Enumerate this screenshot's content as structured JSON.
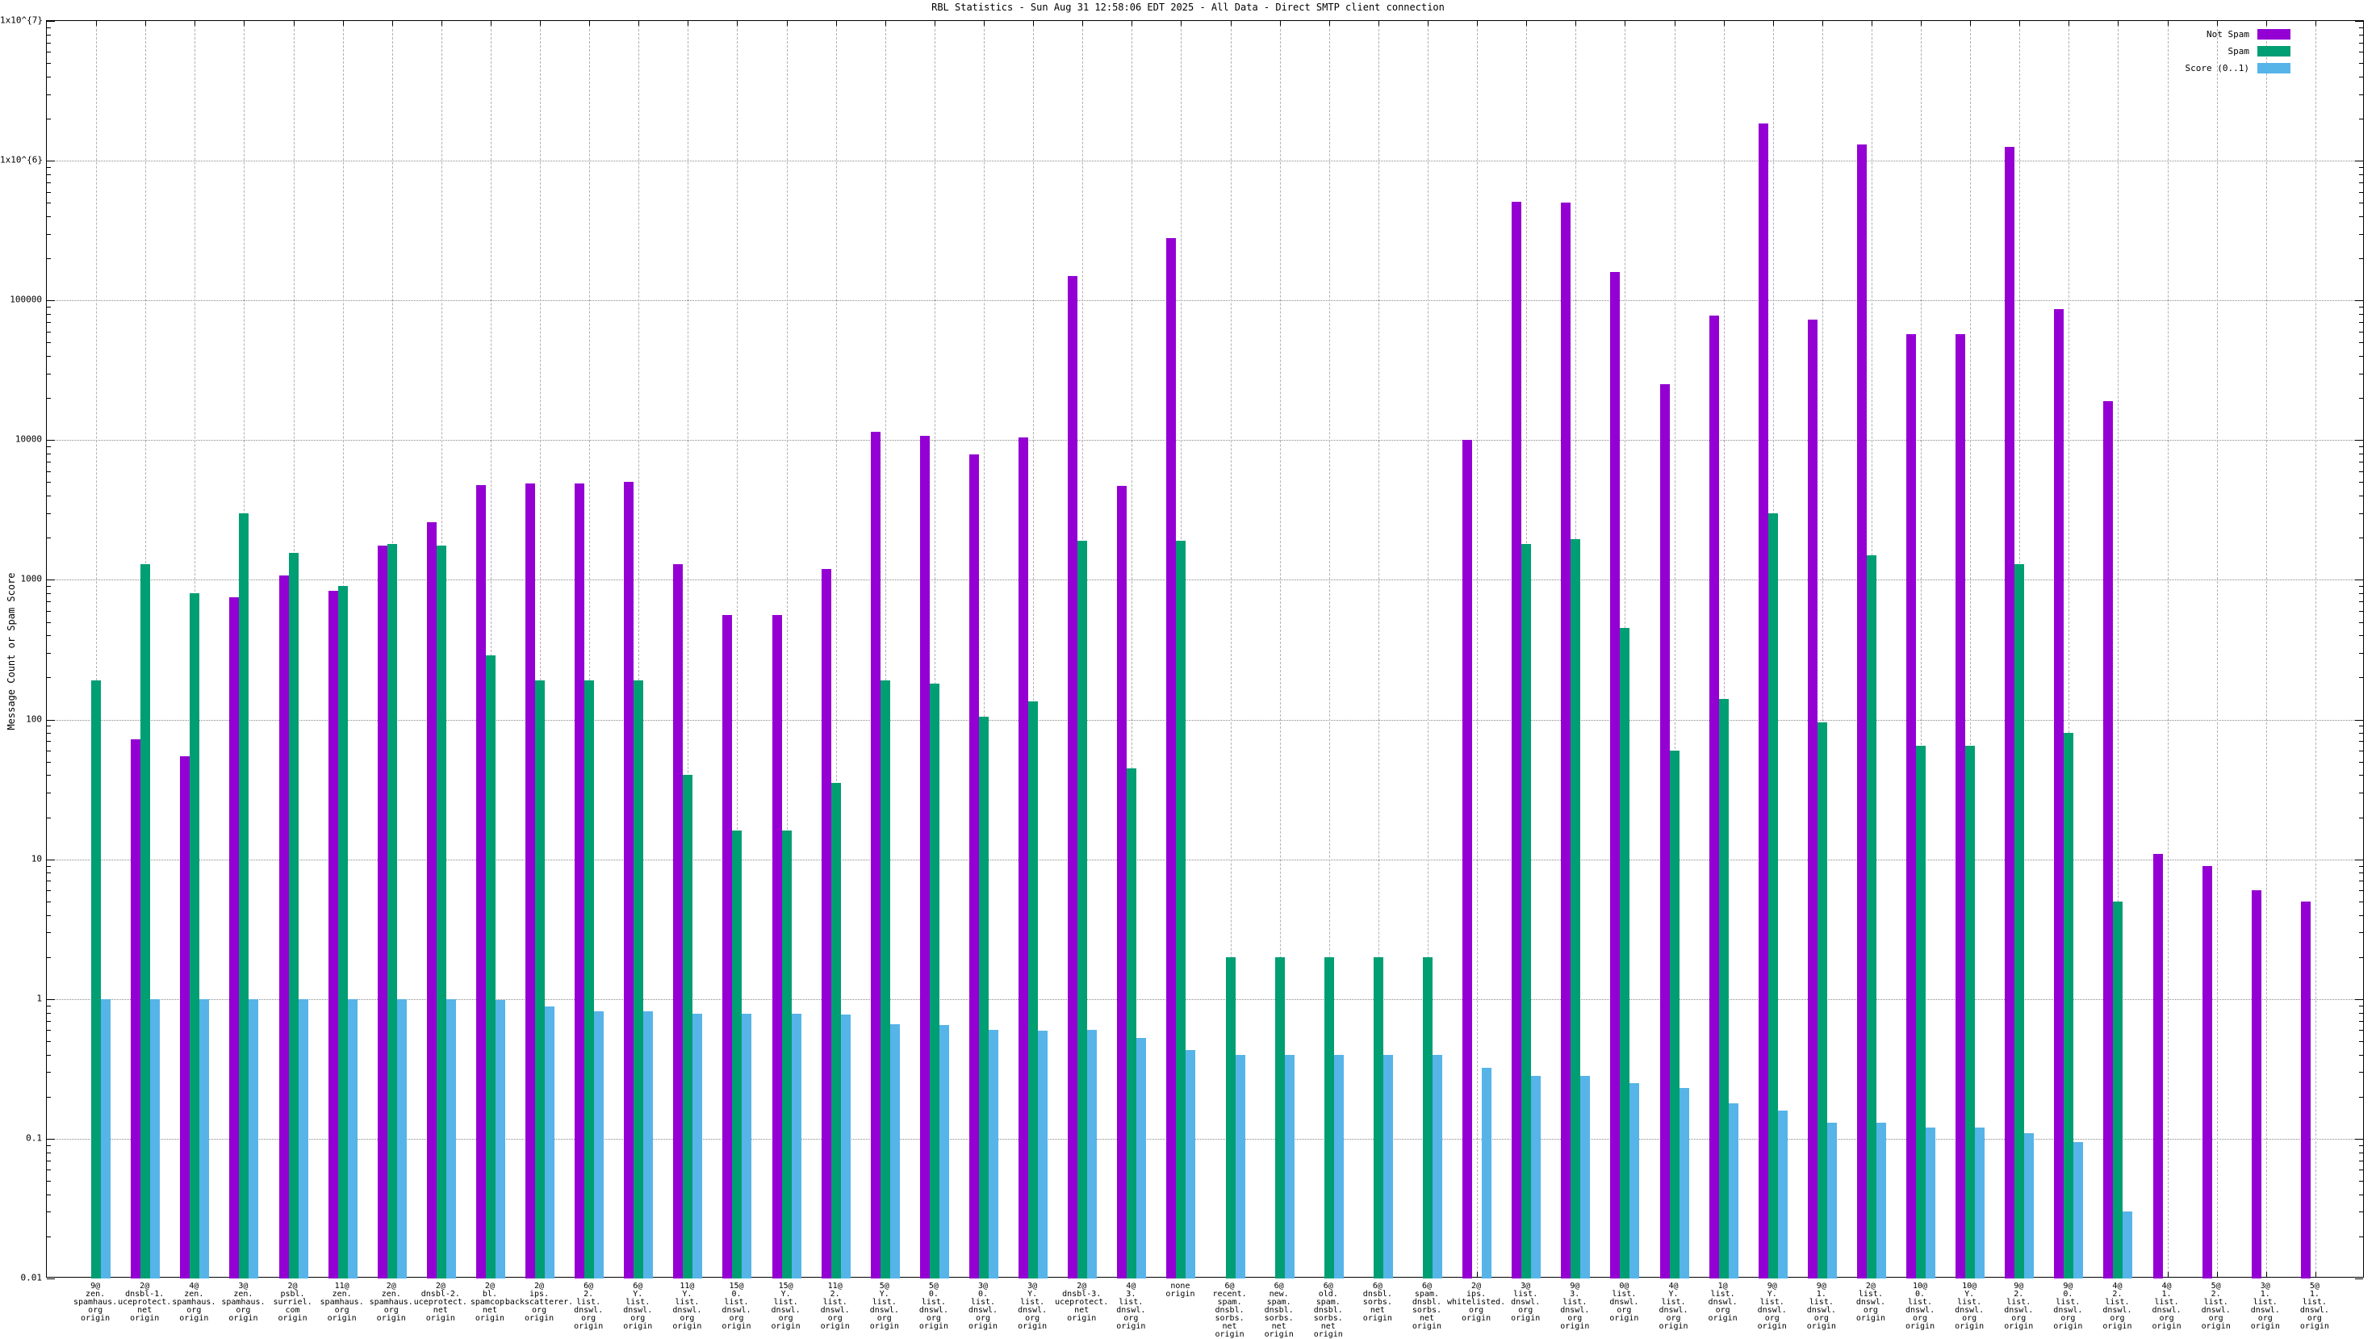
{
  "title": "RBL Statistics - Sun Aug 31 12:58:06 EDT 2025 - All Data - Direct SMTP client connection",
  "y_axis": {
    "label": "Message Count or Spam Score",
    "ticks": [
      {
        "v": 0.01,
        "label": "0.01"
      },
      {
        "v": 0.1,
        "label": "0.1"
      },
      {
        "v": 1,
        "label": "1"
      },
      {
        "v": 10,
        "label": "10"
      },
      {
        "v": 100,
        "label": "100"
      },
      {
        "v": 1000,
        "label": "1000"
      },
      {
        "v": 10000,
        "label": "10000"
      },
      {
        "v": 100000,
        "label": "100000"
      },
      {
        "v": 1000000,
        "label": "1x10^{6}"
      },
      {
        "v": 10000000,
        "label": "1x10^{7}"
      }
    ]
  },
  "legend": [
    {
      "label": "Not Spam",
      "series": "not_spam",
      "color": "#9400d3"
    },
    {
      "label": "Spam",
      "series": "spam",
      "color": "#009e73"
    },
    {
      "label": "Score (0..1)",
      "series": "score",
      "color": "#56b4e9"
    }
  ],
  "chart_data": {
    "type": "bar",
    "log_scale": true,
    "ylim": [
      0.01,
      10000000
    ],
    "grid": true,
    "legend_position": "top-right",
    "series_names": [
      "Not Spam",
      "Spam",
      "Score (0..1)"
    ],
    "colors": {
      "not_spam": "#9400d3",
      "spam": "#009e73",
      "score": "#56b4e9"
    },
    "groups": [
      {
        "label": "9@zen.spamhaus.org origin",
        "label_lines": [
          "9@",
          "zen.",
          "spamhaus.",
          "org",
          "origin"
        ],
        "not_spam": null,
        "spam": 190,
        "score": 1.0
      },
      {
        "label": "2@dnsbl-1.uceprotect.net origin",
        "label_lines": [
          "2@",
          "dnsbl-1.",
          "uceprotect.",
          "net",
          "origin"
        ],
        "not_spam": 72,
        "spam": 1300,
        "score": 1.0
      },
      {
        "label": "4@zen.spamhaus.org origin",
        "label_lines": [
          "4@",
          "zen.",
          "spamhaus.",
          "org",
          "origin"
        ],
        "not_spam": 55,
        "spam": 800,
        "score": 1.0
      },
      {
        "label": "3@zen.spamhaus.org origin",
        "label_lines": [
          "3@",
          "zen.",
          "spamhaus.",
          "org",
          "origin"
        ],
        "not_spam": 750,
        "spam": 3000,
        "score": 1.0
      },
      {
        "label": "2@psbl.surriel.com origin",
        "label_lines": [
          "2@",
          "psbl.",
          "surriel.",
          "com",
          "origin"
        ],
        "not_spam": 1080,
        "spam": 1550,
        "score": 1.0
      },
      {
        "label": "11@zen.spamhaus.org origin",
        "label_lines": [
          "11@",
          "zen.",
          "spamhaus.",
          "org",
          "origin"
        ],
        "not_spam": 830,
        "spam": 910,
        "score": 1.0
      },
      {
        "label": "2@zen.spamhaus.org origin",
        "label_lines": [
          "2@",
          "zen.",
          "spamhaus.",
          "org",
          "origin"
        ],
        "not_spam": 1750,
        "spam": 1800,
        "score": 1.0
      },
      {
        "label": "2@dnsbl-2.uceprotect.net origin",
        "label_lines": [
          "2@",
          "dnsbl-2.",
          "uceprotect.",
          "net",
          "origin"
        ],
        "not_spam": 2600,
        "spam": 1750,
        "score": 1.0
      },
      {
        "label": "2@bl.spamcop.net origin",
        "label_lines": [
          "2@",
          "bl.",
          "spamcop.",
          "net",
          "origin"
        ],
        "not_spam": 4800,
        "spam": 290,
        "score": 0.98
      },
      {
        "label": "2@ips.backscatterer.org origin",
        "label_lines": [
          "2@",
          "ips.",
          "backscatterer.",
          "org",
          "origin"
        ],
        "not_spam": 4900,
        "spam": 190,
        "score": 0.88
      },
      {
        "label": "6@2.list.dnswl.org origin",
        "label_lines": [
          "6@",
          "2.",
          "list.",
          "dnswl.",
          "org",
          "origin"
        ],
        "not_spam": 4900,
        "spam": 190,
        "score": 0.82
      },
      {
        "label": "6@Y.list.dnswl.org origin",
        "label_lines": [
          "6@",
          "Y.",
          "list.",
          "dnswl.",
          "org",
          "origin"
        ],
        "not_spam": 5000,
        "spam": 190,
        "score": 0.82
      },
      {
        "label": "11@Y.list.dnswl.org origin",
        "label_lines": [
          "11@",
          "Y.",
          "list.",
          "dnswl.",
          "org",
          "origin"
        ],
        "not_spam": 1300,
        "spam": 40,
        "score": 0.78
      },
      {
        "label": "15@0.list.dnswl.org origin",
        "label_lines": [
          "15@",
          "0.",
          "list.",
          "dnswl.",
          "org",
          "origin"
        ],
        "not_spam": 560,
        "spam": 16,
        "score": 0.78
      },
      {
        "label": "15@Y.list.dnswl.org origin",
        "label_lines": [
          "15@",
          "Y.",
          "list.",
          "dnswl.",
          "org",
          "origin"
        ],
        "not_spam": 560,
        "spam": 16,
        "score": 0.78
      },
      {
        "label": "11@2.list.dnswl.org origin",
        "label_lines": [
          "11@",
          "2.",
          "list.",
          "dnswl.",
          "org",
          "origin"
        ],
        "not_spam": 1200,
        "spam": 35,
        "score": 0.77
      },
      {
        "label": "5@Y.list.dnswl.org origin",
        "label_lines": [
          "5@",
          "Y.",
          "list.",
          "dnswl.",
          "org",
          "origin"
        ],
        "not_spam": 11500,
        "spam": 190,
        "score": 0.66
      },
      {
        "label": "5@0.list.dnswl.org origin",
        "label_lines": [
          "5@",
          "0.",
          "list.",
          "dnswl.",
          "org",
          "origin"
        ],
        "not_spam": 10700,
        "spam": 180,
        "score": 0.65
      },
      {
        "label": "3@0.list.dnswl.org origin",
        "label_lines": [
          "3@",
          "0.",
          "list.",
          "dnswl.",
          "org",
          "origin"
        ],
        "not_spam": 7900,
        "spam": 105,
        "score": 0.6
      },
      {
        "label": "3@Y.list.dnswl.org origin",
        "label_lines": [
          "3@",
          "Y.",
          "list.",
          "dnswl.",
          "org",
          "origin"
        ],
        "not_spam": 10500,
        "spam": 135,
        "score": 0.59
      },
      {
        "label": "2@dnsbl-3.uceprotect.net origin",
        "label_lines": [
          "2@",
          "dnsbl-3.",
          "uceprotect.",
          "net",
          "origin"
        ],
        "not_spam": 150000,
        "spam": 1900,
        "score": 0.6
      },
      {
        "label": "4@3.list.dnswl.org origin",
        "label_lines": [
          "4@",
          "3.",
          "list.",
          "dnswl.",
          "org",
          "origin"
        ],
        "not_spam": 4700,
        "spam": 45,
        "score": 0.53
      },
      {
        "label": "none origin",
        "label_lines": [
          "none",
          "origin"
        ],
        "not_spam": 280000,
        "spam": 1900,
        "score": 0.43
      },
      {
        "label": "6@recent.spam.dnsbl.sorbs.net origin",
        "label_lines": [
          "6@",
          "recent.",
          "spam.",
          "dnsbl.",
          "sorbs.",
          "net",
          "origin"
        ],
        "not_spam": null,
        "spam": 2,
        "score": 0.4
      },
      {
        "label": "6@new.spam.dnsbl.sorbs.net origin",
        "label_lines": [
          "6@",
          "new.",
          "spam.",
          "dnsbl.",
          "sorbs.",
          "net",
          "origin"
        ],
        "not_spam": null,
        "spam": 2,
        "score": 0.4
      },
      {
        "label": "6@old.spam.dnsbl.sorbs.net origin",
        "label_lines": [
          "6@",
          "old.",
          "spam.",
          "dnsbl.",
          "sorbs.",
          "net",
          "origin"
        ],
        "not_spam": null,
        "spam": 2,
        "score": 0.4
      },
      {
        "label": "6@dnsbl.sorbs.net origin",
        "label_lines": [
          "6@",
          "dnsbl.",
          "sorbs.",
          "net",
          "origin"
        ],
        "not_spam": null,
        "spam": 2,
        "score": 0.4
      },
      {
        "label": "6@spam.dnsbl.sorbs.net origin",
        "label_lines": [
          "6@",
          "spam.",
          "dnsbl.",
          "sorbs.",
          "net",
          "origin"
        ],
        "not_spam": null,
        "spam": 2,
        "score": 0.4
      },
      {
        "label": "2@ips.whitelisted.org origin",
        "label_lines": [
          "2@",
          "ips.",
          "whitelisted.",
          "org",
          "origin"
        ],
        "not_spam": 10000,
        "spam": null,
        "score": 0.32
      },
      {
        "label": "3@list.dnswl.org origin",
        "label_lines": [
          "3@",
          "list.",
          "dnswl.",
          "org",
          "origin"
        ],
        "not_spam": 510000,
        "spam": 1800,
        "score": 0.28
      },
      {
        "label": "9@3.list.dnswl.org origin",
        "label_lines": [
          "9@",
          "3.",
          "list.",
          "dnswl.",
          "org",
          "origin"
        ],
        "not_spam": 500000,
        "spam": 1950,
        "score": 0.28
      },
      {
        "label": "0@list.dnswl.org origin",
        "label_lines": [
          "0@",
          "list.",
          "dnswl.",
          "org",
          "origin"
        ],
        "not_spam": 160000,
        "spam": 450,
        "score": 0.25
      },
      {
        "label": "4@Y.list.dnswl.org origin",
        "label_lines": [
          "4@",
          "Y.",
          "list.",
          "dnswl.",
          "org",
          "origin"
        ],
        "not_spam": 25000,
        "spam": 60,
        "score": 0.23
      },
      {
        "label": "1@list.dnswl.org origin",
        "label_lines": [
          "1@",
          "list.",
          "dnswl.",
          "org",
          "origin"
        ],
        "not_spam": 78000,
        "spam": 140,
        "score": 0.18
      },
      {
        "label": "9@Y.list.dnswl.org origin",
        "label_lines": [
          "9@",
          "Y.",
          "list.",
          "dnswl.",
          "org",
          "origin"
        ],
        "not_spam": 1850000,
        "spam": 3000,
        "score": 0.16
      },
      {
        "label": "9@1.list.dnswl.org origin",
        "label_lines": [
          "9@",
          "1.",
          "list.",
          "dnswl.",
          "org",
          "origin"
        ],
        "not_spam": 73000,
        "spam": 95,
        "score": 0.13
      },
      {
        "label": "2@list.dnswl.org origin",
        "label_lines": [
          "2@",
          "list.",
          "dnswl.",
          "org",
          "origin"
        ],
        "not_spam": 1300000,
        "spam": 1500,
        "score": 0.13
      },
      {
        "label": "10@0.list.dnswl.org origin",
        "label_lines": [
          "10@",
          "0.",
          "list.",
          "dnswl.",
          "org",
          "origin"
        ],
        "not_spam": 57000,
        "spam": 65,
        "score": 0.12
      },
      {
        "label": "10@Y.list.dnswl.org origin",
        "label_lines": [
          "10@",
          "Y.",
          "list.",
          "dnswl.",
          "org",
          "origin"
        ],
        "not_spam": 57000,
        "spam": 65,
        "score": 0.12
      },
      {
        "label": "9@2.list.dnswl.org origin",
        "label_lines": [
          "9@",
          "2.",
          "list.",
          "dnswl.",
          "org",
          "origin"
        ],
        "not_spam": 1250000,
        "spam": 1300,
        "score": 0.11
      },
      {
        "label": "9@0.list.dnswl.org origin",
        "label_lines": [
          "9@",
          "0.",
          "list.",
          "dnswl.",
          "org",
          "origin"
        ],
        "not_spam": 87000,
        "spam": 80,
        "score": 0.095
      },
      {
        "label": "4@2.list.dnswl.org origin",
        "label_lines": [
          "4@",
          "2.",
          "list.",
          "dnswl.",
          "org",
          "origin"
        ],
        "not_spam": 19000,
        "spam": 5,
        "score": 0.03
      },
      {
        "label": "4@1.list.dnswl.org origin",
        "label_lines": [
          "4@",
          "1.",
          "list.",
          "dnswl.",
          "org",
          "origin"
        ],
        "not_spam": 11,
        "spam": null,
        "score": null
      },
      {
        "label": "5@2.list.dnswl.org origin",
        "label_lines": [
          "5@",
          "2.",
          "list.",
          "dnswl.",
          "org",
          "origin"
        ],
        "not_spam": 9,
        "spam": null,
        "score": null
      },
      {
        "label": "3@1.list.dnswl.org origin",
        "label_lines": [
          "3@",
          "1.",
          "list.",
          "dnswl.",
          "org",
          "origin"
        ],
        "not_spam": 6,
        "spam": null,
        "score": null
      },
      {
        "label": "5@1.list.dnswl.org origin",
        "label_lines": [
          "5@",
          "1.",
          "list.",
          "dnswl.",
          "org",
          "origin"
        ],
        "not_spam": 5,
        "spam": null,
        "score": null
      }
    ]
  }
}
